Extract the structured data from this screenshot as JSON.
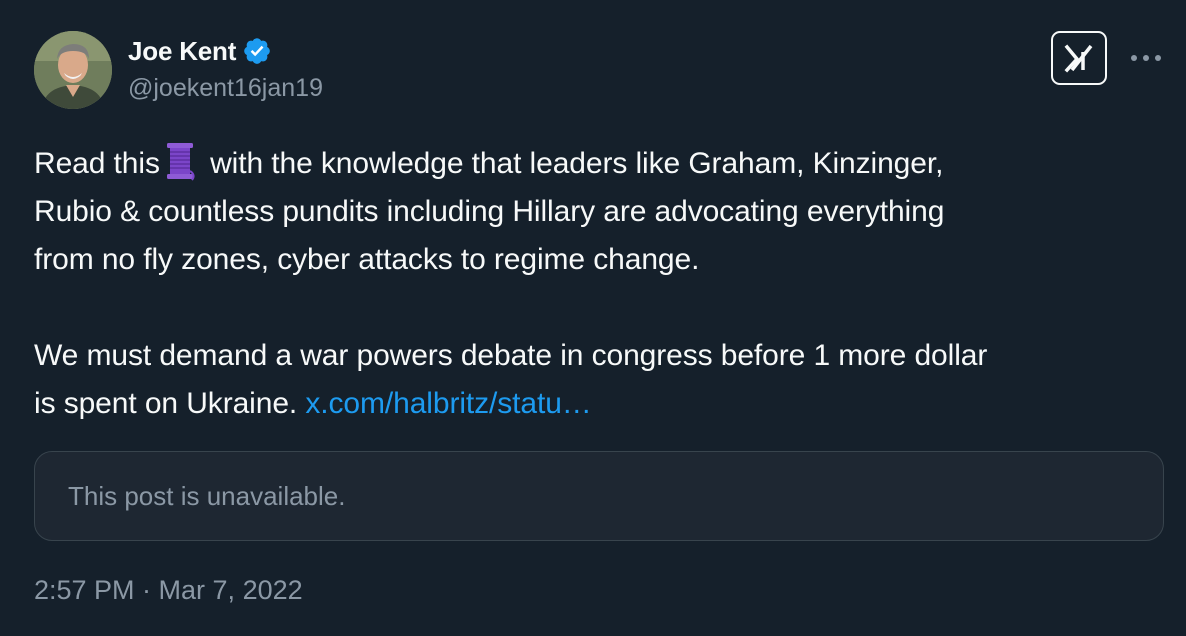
{
  "author": {
    "display_name": "Joe Kent",
    "handle": "@joekent16jan19",
    "verified_icon": "verified-badge-icon",
    "verified_color": "#1d9bf0"
  },
  "header": {
    "brand_icon": "x-logo-icon",
    "more_icon": "more-options-icon"
  },
  "post": {
    "line1_a": "Read this",
    "emoji": "thread-spool-emoji",
    "line1_b": " with the knowledge that leaders like Graham, Kinzinger,",
    "line2": "Rubio & countless pundits including Hillary are advocating everything",
    "line3": "from no fly zones, cyber attacks to regime change.",
    "para2_line1": "We must demand a war powers debate in congress before 1 more dollar",
    "para2_line2": "is spent on Ukraine. ",
    "link_text": "x.com/halbritz/statu…"
  },
  "quoted_post": {
    "unavailable_text": "This post is unavailable."
  },
  "meta": {
    "timestamp": "2:57 PM · Mar 7, 2022"
  },
  "colors": {
    "background": "#15202b",
    "text": "#f7f9f9",
    "muted": "#8b98a5",
    "link": "#1d9bf0",
    "border": "#38444d"
  }
}
